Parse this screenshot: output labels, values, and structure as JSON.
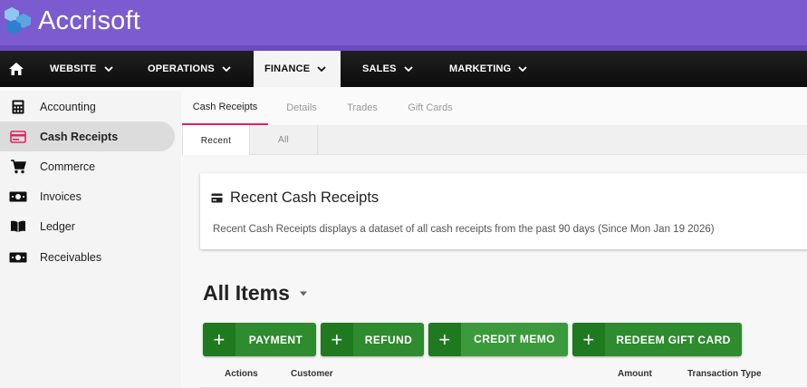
{
  "app": {
    "name": "Accrisoft"
  },
  "nav": {
    "items": [
      {
        "label": "WEBSITE"
      },
      {
        "label": "OPERATIONS"
      },
      {
        "label": "FINANCE",
        "active": true
      },
      {
        "label": "SALES"
      },
      {
        "label": "MARKETING"
      }
    ]
  },
  "sidebar": {
    "items": [
      {
        "label": "Accounting",
        "icon": "calculator-icon"
      },
      {
        "label": "Cash Receipts",
        "icon": "card-icon",
        "active": true
      },
      {
        "label": "Commerce",
        "icon": "cart-icon"
      },
      {
        "label": "Invoices",
        "icon": "money-icon"
      },
      {
        "label": "Ledger",
        "icon": "book-icon"
      },
      {
        "label": "Receivables",
        "icon": "money-icon"
      }
    ]
  },
  "subtabs": [
    {
      "label": "Cash Receipts",
      "active": true
    },
    {
      "label": "Details"
    },
    {
      "label": "Trades"
    },
    {
      "label": "Gift Cards"
    }
  ],
  "inner_tabs": [
    {
      "label": "Recent",
      "active": true
    },
    {
      "label": "All"
    }
  ],
  "card": {
    "title": "Recent Cash Receipts",
    "description": "Recent Cash Receipts displays a dataset of all cash receipts from the past 90 days (Since Mon Jan 19 2026)"
  },
  "list": {
    "title": "All Items",
    "buttons": [
      {
        "label": "PAYMENT"
      },
      {
        "label": "REFUND"
      },
      {
        "label": "CREDIT MEMO"
      },
      {
        "label": "REDEEM GIFT CARD"
      }
    ],
    "columns": [
      "Actions",
      "Customer",
      "Amount",
      "Transaction Type"
    ]
  },
  "colors": {
    "header": "#7b5bcf",
    "accent": "#e91e63",
    "button": "#2e8b2e"
  }
}
